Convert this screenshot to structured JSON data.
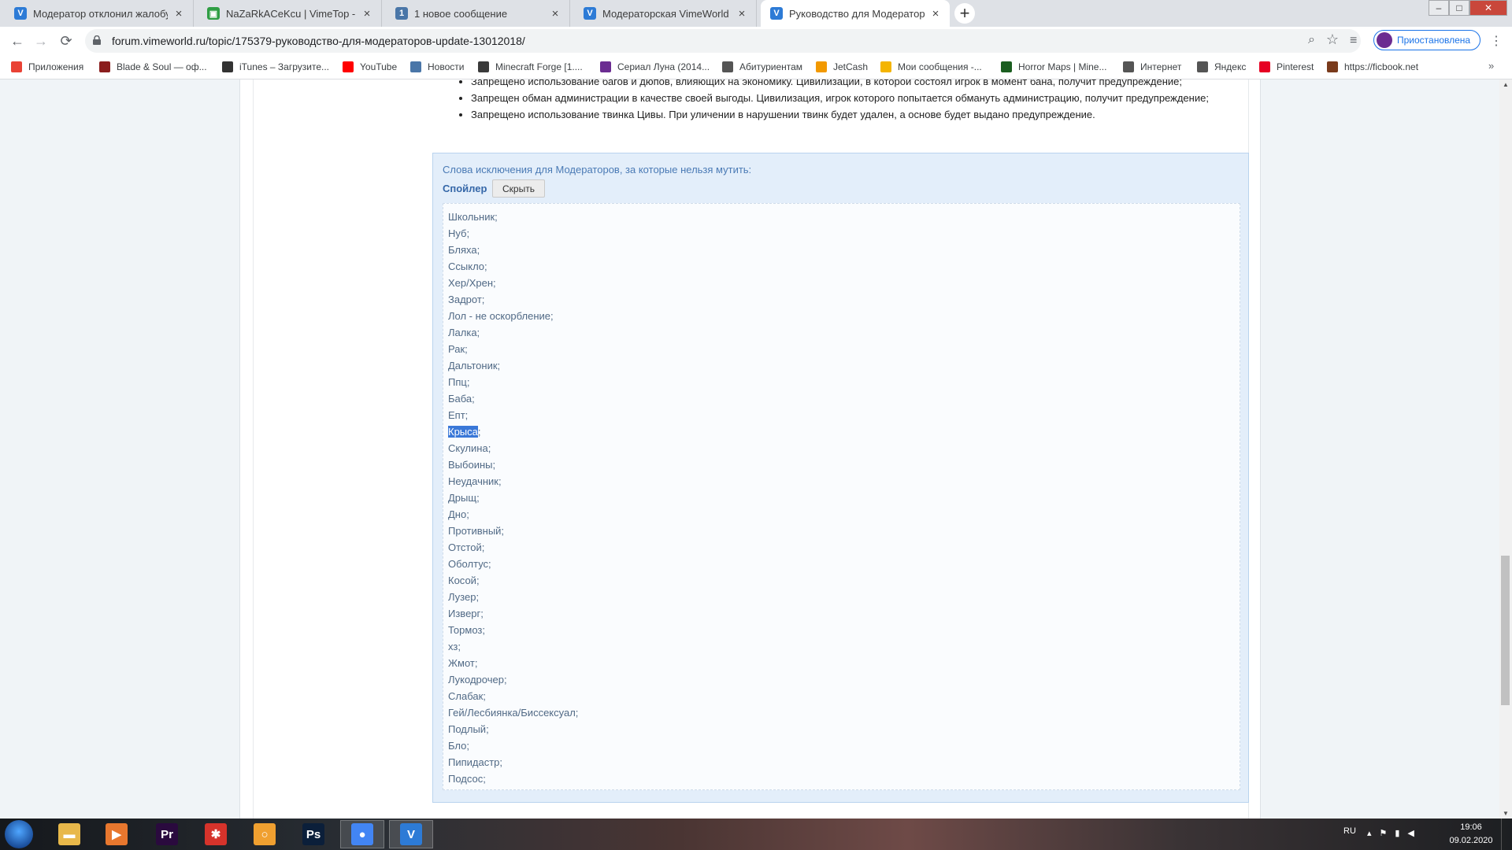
{
  "browser": {
    "tabs": [
      {
        "title": "Модератор отклонил жалобу - ",
        "favicon": "vimeworld-icon",
        "color": "#2d7bd6",
        "glyph": "V"
      },
      {
        "title": "NaZaRkACeKcu | VimeTop - стат",
        "favicon": "vimetop-icon",
        "color": "#2f9e44",
        "glyph": "▣"
      },
      {
        "title": "1 новое сообщение",
        "favicon": "vk-notification-icon",
        "color": "#4a76a8",
        "glyph": "1"
      },
      {
        "title": "Модераторская VimeWorld",
        "favicon": "vimeworld-icon",
        "color": "#2d7bd6",
        "glyph": "V"
      },
      {
        "title": "Руководство для Модераторов",
        "favicon": "vimeworld-icon",
        "color": "#2d7bd6",
        "glyph": "V",
        "active": true
      }
    ],
    "new_tab_glyph": "+",
    "url": "forum.vimeworld.ru/topic/175379-руководство-для-модераторов-update-13012018/",
    "profile_label": "Приостановлена"
  },
  "bookmarks": [
    {
      "label": "Приложения",
      "icon": "apps-grid-icon",
      "color": "#e94235"
    },
    {
      "label": "Blade & Soul — оф...",
      "icon": "blade-soul-icon",
      "color": "#8b1e1e"
    },
    {
      "label": "iTunes – Загрузите...",
      "icon": "apple-icon",
      "color": "#333333"
    },
    {
      "label": "YouTube",
      "icon": "youtube-icon",
      "color": "#ff0000"
    },
    {
      "label": "Новости",
      "icon": "vk-icon",
      "color": "#4a76a8"
    },
    {
      "label": "Minecraft Forge [1....",
      "icon": "minecraft-forge-icon",
      "color": "#3a3a3a"
    },
    {
      "label": "Сериал Луна (2014...",
      "icon": "film-icon",
      "color": "#6b2c91"
    },
    {
      "label": "Абитуриентам",
      "icon": "globe-icon",
      "color": "#555555"
    },
    {
      "label": "JetCash",
      "icon": "jetcash-icon",
      "color": "#f29900"
    },
    {
      "label": "Мои сообщения -...",
      "icon": "messages-icon",
      "color": "#f4b400"
    },
    {
      "label": "Horror Maps | Mine...",
      "icon": "horror-maps-icon",
      "color": "#1b5e20"
    },
    {
      "label": "Интернет",
      "icon": "globe-icon",
      "color": "#555555"
    },
    {
      "label": "Яндекс",
      "icon": "globe-icon",
      "color": "#555555"
    },
    {
      "label": "Pinterest",
      "icon": "pinterest-icon",
      "color": "#e60023"
    },
    {
      "label": "https://ficbook.net",
      "icon": "ficbook-icon",
      "color": "#7a3b1c"
    }
  ],
  "post": {
    "rules": [
      "Запрещено использование багов и дюпов, влияющих на экономику. Цивилизации, в которой состоял игрок в момент бана, получит предупреждение;",
      "Запрещен обман администрации в качестве своей выгоды. Цивилизация, игрок которого попытается обмануть администрацию, получит предупреждение;",
      "Запрещено использование твинка Цивы. При уличении в нарушении твинк будет удален, а основе будет выдано предупреждение."
    ],
    "spoiler": {
      "caption": "Слова исключения для Модераторов, за которые нельзя мутить:",
      "label": "Спойлер",
      "hide_label": "Скрыть",
      "words": [
        "Школьник;",
        "Нуб;",
        "Бляха;",
        "Ссыкло;",
        "Хер/Хрен;",
        "Задрот;",
        "Лол - не оскорбление;",
        "Лалка;",
        "Рак;",
        "Дальтоник;",
        "Ппц;",
        "Баба;",
        "Епт;",
        "Крыса;",
        "Скулина;",
        "Выбоины;",
        "Неудачник;",
        "Дрыщ;",
        "Дно;",
        "Противный;",
        "Отстой;",
        "Оболтус;",
        "Косой;",
        "Лузер;",
        "Изверг;",
        "Тормоз;",
        "хз;",
        "Жмот;",
        "Лукодрочер;",
        "Слабак;",
        "Гей/Лесбиянка/Биссексуал;",
        "Подлый;",
        "Бло;",
        "Пипидастр;",
        "Подсос;"
      ],
      "selected_index": 13,
      "selected_text": "Крыса"
    }
  },
  "taskbar": {
    "apps": [
      {
        "name": "explorer",
        "icon": "folder-icon",
        "color": "#e8b84a",
        "glyph": "▬"
      },
      {
        "name": "media-player",
        "icon": "media-player-icon",
        "color": "#e8772e",
        "glyph": "▶"
      },
      {
        "name": "premiere",
        "icon": "premiere-icon",
        "color": "#2a0a3e",
        "glyph": "Pr"
      },
      {
        "name": "paint-tool",
        "icon": "paint-tool-icon",
        "color": "#d6332b",
        "glyph": "✱"
      },
      {
        "name": "search-app",
        "icon": "magnifier-app-icon",
        "color": "#f0a030",
        "glyph": "○"
      },
      {
        "name": "photoshop",
        "icon": "photoshop-icon",
        "color": "#0b1f3a",
        "glyph": "Ps"
      },
      {
        "name": "chrome",
        "icon": "chrome-icon",
        "color": "#4285f4",
        "glyph": "●",
        "running": true
      },
      {
        "name": "vimeworld",
        "icon": "vimeworld-app-icon",
        "color": "#2d7bd6",
        "glyph": "V",
        "running": true
      }
    ],
    "lang": "RU",
    "time": "19:06",
    "date": "09.02.2020"
  }
}
